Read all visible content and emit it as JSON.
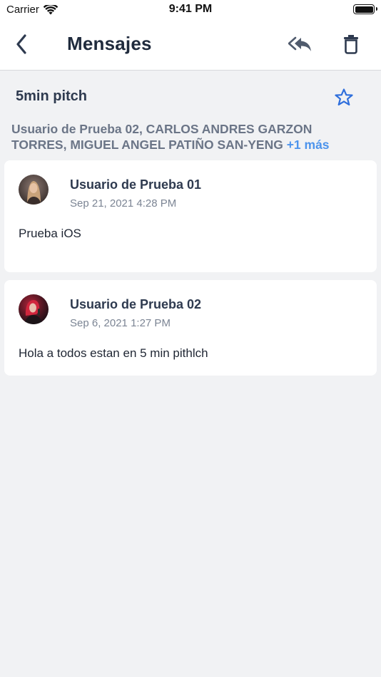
{
  "status_bar": {
    "carrier": "Carrier",
    "time": "9:41 PM"
  },
  "nav": {
    "title": "Mensajes",
    "icons": {
      "back": "chevron-left-icon",
      "reply_all": "reply-all-icon",
      "delete": "trash-icon"
    }
  },
  "thread": {
    "subject": "5min pitch",
    "starred": false,
    "recipients": "Usuario de Prueba 02, CARLOS ANDRES GARZON TORRES, MIGUEL ANGEL PATIÑO SAN-YENG",
    "more_label": "+1 más"
  },
  "messages": [
    {
      "sender": "Usuario de Prueba 01",
      "date": "Sep 21, 2021 4:28 PM",
      "body": "Prueba iOS"
    },
    {
      "sender": "Usuario de Prueba 02",
      "date": "Sep 6, 2021 1:27 PM",
      "body": "Hola a todos estan en 5 min pithlch"
    }
  ],
  "colors": {
    "accent": "#4d94ec",
    "star": "#2f6fdc",
    "background": "#f1f2f4",
    "text": "#2e3a4f",
    "secondary_text": "#7c8594"
  }
}
